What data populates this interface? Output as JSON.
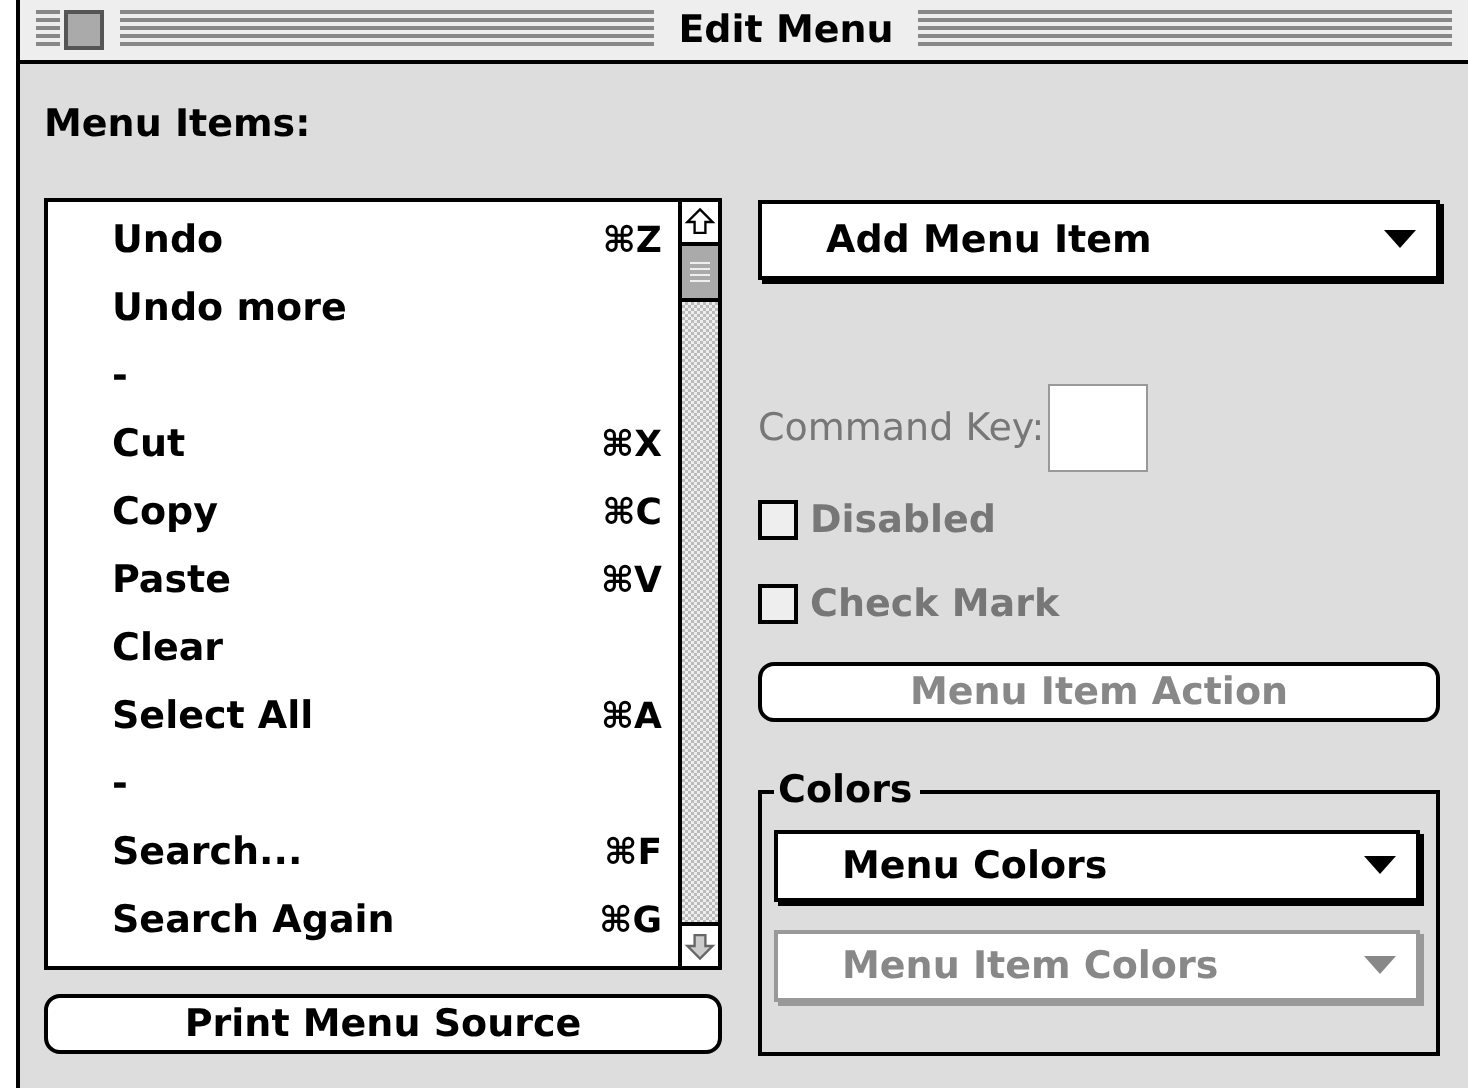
{
  "window": {
    "title": "Edit Menu"
  },
  "menu_items_label": "Menu Items:",
  "menu_items": [
    {
      "label": "Undo",
      "shortcut": "⌘Z"
    },
    {
      "label": "Undo more"
    },
    {
      "label": "-"
    },
    {
      "label": "Cut",
      "shortcut": "⌘X"
    },
    {
      "label": "Copy",
      "shortcut": "⌘C"
    },
    {
      "label": "Paste",
      "shortcut": "⌘V"
    },
    {
      "label": "Clear"
    },
    {
      "label": "Select All",
      "shortcut": "⌘A"
    },
    {
      "label": "-"
    },
    {
      "label": "Search...",
      "shortcut": "⌘F"
    },
    {
      "label": "Search Again",
      "shortcut": "⌘G"
    }
  ],
  "print_button": {
    "label": "Print Menu Source",
    "disabled": false
  },
  "add_popup": {
    "label": "Add Menu Item",
    "disabled": false
  },
  "command_key": {
    "label": "Command Key:",
    "disabled": true
  },
  "checkboxes": [
    {
      "label": "Disabled",
      "checked": false,
      "disabled": true
    },
    {
      "label": "Check Mark",
      "checked": false,
      "disabled": true
    }
  ],
  "action_button": {
    "label": "Menu Item Action",
    "disabled": true
  },
  "colors": {
    "title": "Colors",
    "popups": [
      {
        "label": "Menu Colors",
        "disabled": false
      },
      {
        "label": "Menu Item Colors",
        "disabled": true
      }
    ]
  }
}
